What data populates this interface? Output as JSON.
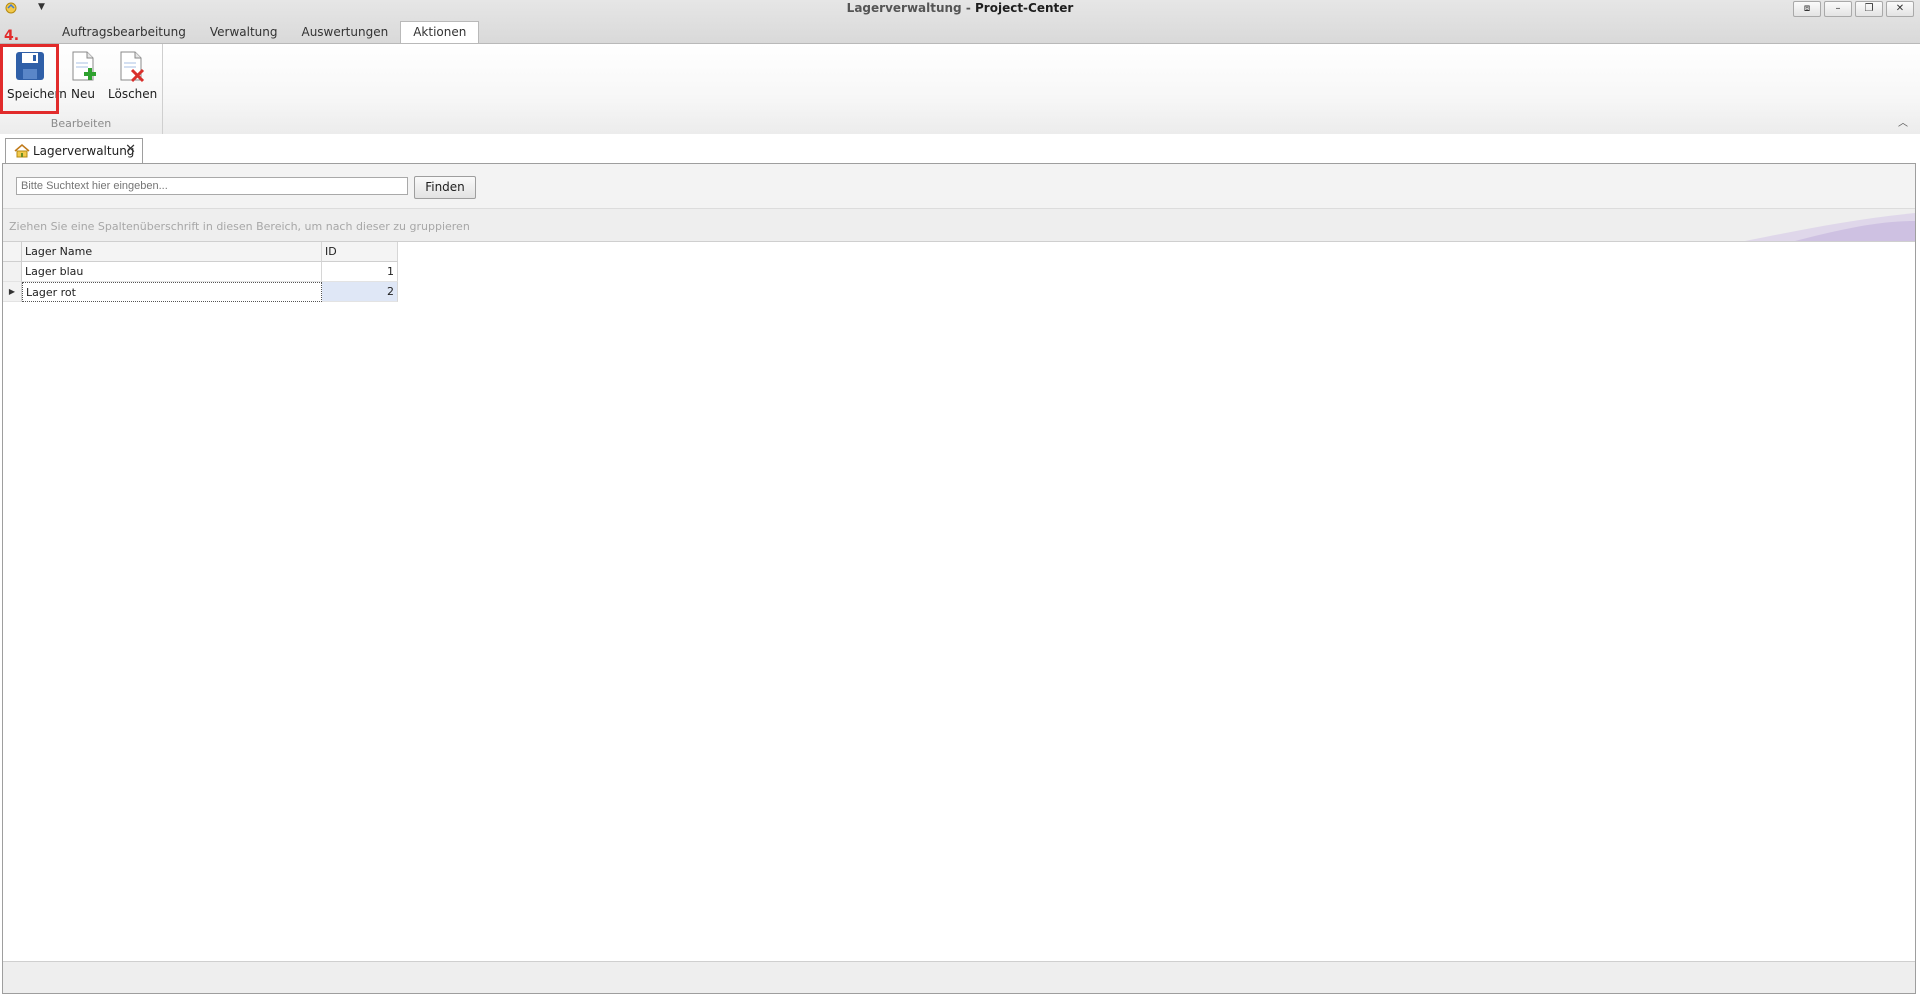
{
  "window": {
    "title_part1": "Lagerverwaltung -",
    "title_part2": "Project-Center",
    "controls": [
      "restore-screen",
      "minimize",
      "restore",
      "close"
    ]
  },
  "ribbon": {
    "tabs": [
      "Auftragsbearbeitung",
      "Verwaltung",
      "Auswertungen",
      "Aktionen"
    ],
    "active_tab": "Aktionen",
    "group": {
      "label": "Bearbeiten",
      "buttons": [
        {
          "label": "Speichern",
          "icon": "save-icon"
        },
        {
          "label": "Neu",
          "icon": "new-document-icon"
        },
        {
          "label": "Löschen",
          "icon": "delete-document-icon"
        }
      ]
    },
    "annotation": {
      "step": "4.",
      "color": "#e12b2b"
    }
  },
  "document_tab": {
    "label": "Lagerverwaltung",
    "icon": "home-icon"
  },
  "search": {
    "placeholder": "Bitte Suchtext hier eingeben...",
    "find_label": "Finden"
  },
  "group_panel": {
    "hint": "Ziehen Sie eine Spaltenüberschrift in diesen Bereich, um nach dieser zu gruppieren"
  },
  "grid": {
    "columns": [
      "Lager Name",
      "ID"
    ],
    "rows": [
      {
        "name": "Lager blau",
        "id": "1"
      },
      {
        "name": "Lager rot",
        "id": "2"
      }
    ],
    "focused_row": 1
  }
}
